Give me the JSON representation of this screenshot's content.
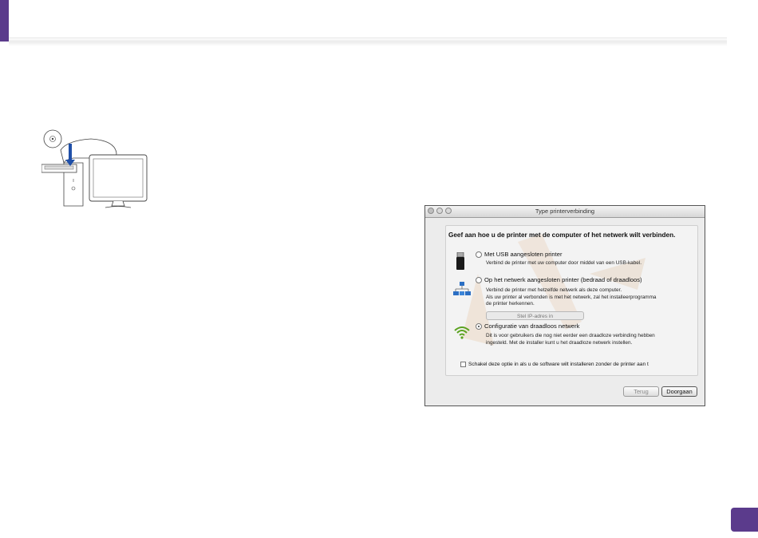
{
  "dialog": {
    "title": "Type printerverbinding",
    "heading": "Geef aan hoe u de printer met de computer of het netwerk wilt verbinden.",
    "options": [
      {
        "label": "Met USB aangesloten printer",
        "description": "Verbind de printer met uw computer door middel van een USB-kabel.",
        "selected": false,
        "icon": "usb-icon"
      },
      {
        "label": "Op het netwerk aangesloten printer (bedraad of draadloos)",
        "description_line1": "Verbind de printer met hetzelfde netwerk als deze computer.",
        "description_line2": "Als uw printer al verbonden is met het netwerk, zal het installeerprogramma",
        "description_line3": "de printer herkennen.",
        "button": "Stel IP-adres in",
        "selected": false,
        "icon": "network-icon"
      },
      {
        "label": "Configuratie van draadloos netwerk",
        "description_line1": "Dit is voor gebruikers die nog niet eerder een draadloze verbinding hebben",
        "description_line2": "ingesteld. Met de installer kunt u het draadloze netwerk instellen.",
        "selected": true,
        "icon": "wifi-icon"
      }
    ],
    "skip_checkbox_label": "Schakel deze optie in als u de software wilt installeren zonder de printer aan t",
    "skip_checked": false,
    "back_label": "Terug",
    "next_label": "Doorgaan"
  },
  "colors": {
    "accent": "#5b3b8c",
    "wifi_green": "#5aa21f"
  }
}
